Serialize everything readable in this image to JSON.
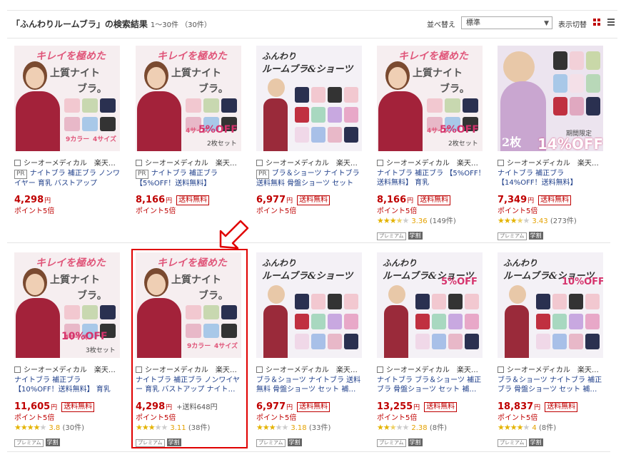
{
  "header": {
    "title": "「ふんわりルームブラ」の検索結果",
    "count": "1～30件 （30件）",
    "sort_label": "並べ替え",
    "sort_value": "標準",
    "view_label": "表示切替"
  },
  "colors": {
    "accent": "#bf0000",
    "link": "#1f3f8a",
    "star": "#e4b300",
    "highlight": "#e00000"
  },
  "products": [
    {
      "shop": "シーオーメディカル　楽天…",
      "pr": "PR",
      "name": "ナイトブラ 補正ブラ ノンワイヤー 育乳 バストアップ",
      "price": "4,298",
      "yen": "円",
      "shipping": "",
      "shipping_fee": "",
      "point": "ポイント5倍",
      "stars": 0,
      "score": "",
      "reviews": "",
      "badges": false,
      "ad": {
        "top": "キレイを極めた",
        "mid": "上質ナイト",
        "low": "ブラ。",
        "tag1": "9カラー",
        "tag2": "4サイズ",
        "off": "",
        "set": ""
      }
    },
    {
      "shop": "シーオーメディカル　楽天…",
      "pr": "PR",
      "name": "ナイトブラ 補正ブラ 【5%OFF！送料無料】",
      "price": "8,166",
      "yen": "円",
      "shipping": "送料無料",
      "shipping_fee": "",
      "point": "ポイント5倍",
      "stars": 0,
      "score": "",
      "reviews": "",
      "badges": false,
      "ad": {
        "top": "キレイを極めた",
        "mid": "上質ナイト",
        "low": "ブラ。",
        "tag1": "",
        "tag2": "4サイズ",
        "off": "5%OFF",
        "set": "2枚セット"
      }
    },
    {
      "shop": "シーオーメディカル　楽天…",
      "pr": "PR",
      "name": "ブラ＆ショーツ ナイトブラ 送料無料 骨盤ショーツ セット",
      "price": "6,977",
      "yen": "円",
      "shipping": "送料無料",
      "shipping_fee": "",
      "point": "ポイント5倍",
      "stars": 0,
      "score": "",
      "reviews": "",
      "badges": false,
      "ad": {
        "top": "ふんわり",
        "mid": "ルームブラ&ショーツ",
        "low": "",
        "tag1": "",
        "tag2": "",
        "off": "",
        "set": ""
      }
    },
    {
      "shop": "シーオーメディカル　楽天…",
      "pr": "",
      "name": "ナイトブラ 補正ブラ 【5%OFF！送料無料】 育乳",
      "price": "8,166",
      "yen": "円",
      "shipping": "送料無料",
      "shipping_fee": "",
      "point": "ポイント5倍",
      "stars": 3.5,
      "score": "3.36",
      "reviews": "(149件)",
      "badges": true,
      "ad": {
        "top": "キレイを極めた",
        "mid": "上質ナイト",
        "low": "ブラ。",
        "tag1": "",
        "tag2": "4サイズ",
        "off": "5%OFF",
        "set": "2枚セット"
      }
    },
    {
      "shop": "シーオーメディカル　楽天…",
      "pr": "",
      "name": "ナイトブラ 補正ブラ 【14%OFF！送料無料】",
      "price": "7,349",
      "yen": "円",
      "shipping": "送料無料",
      "shipping_fee": "",
      "point": "ポイント5倍",
      "stars": 3.5,
      "score": "3.43",
      "reviews": "(273件)",
      "badges": true,
      "ad": {
        "top": "",
        "mid": "",
        "low": "",
        "tag1": "2枚",
        "tag2": "期間限定",
        "off": "14%OFF",
        "set": ""
      }
    },
    {
      "shop": "シーオーメディカル　楽天…",
      "pr": "",
      "name": "ナイトブラ 補正ブラ 【10%OFF！送料無料】 育乳",
      "price": "11,605",
      "yen": "円",
      "shipping": "送料無料",
      "shipping_fee": "",
      "point": "ポイント5倍",
      "stars": 4,
      "score": "3.8",
      "reviews": "(30件)",
      "badges": true,
      "ad": {
        "top": "キレイを極めた",
        "mid": "上質ナイト",
        "low": "ブラ。",
        "tag1": "",
        "tag2": "4サイズ",
        "off": "10%OFF",
        "set": "3枚セット"
      }
    },
    {
      "shop": "シーオーメディカル　楽天…",
      "pr": "",
      "name": "ナイトブラ 補正ブラ ノンワイヤー 育乳 バストアップ ナイト…",
      "price": "4,298",
      "yen": "円",
      "shipping": "",
      "shipping_fee": "+送料648円",
      "point": "ポイント5倍",
      "stars": 3,
      "score": "3.11",
      "reviews": "(38件)",
      "badges": true,
      "ad": {
        "top": "キレイを極めた",
        "mid": "上質ナイト",
        "low": "ブラ。",
        "tag1": "9カラー",
        "tag2": "4サイズ",
        "off": "",
        "set": ""
      }
    },
    {
      "shop": "シーオーメディカル　楽天…",
      "pr": "",
      "name": "ブラ＆ショーツ ナイトブラ 送料無料 骨盤ショーツ セット 補…",
      "price": "6,977",
      "yen": "円",
      "shipping": "送料無料",
      "shipping_fee": "",
      "point": "ポイント5倍",
      "stars": 3,
      "score": "3.18",
      "reviews": "(33件)",
      "badges": true,
      "ad": {
        "top": "ふんわり",
        "mid": "ルームブラ&ショーツ",
        "low": "",
        "tag1": "",
        "tag2": "",
        "off": "",
        "set": ""
      }
    },
    {
      "shop": "シーオーメディカル　楽天…",
      "pr": "",
      "name": "ナイトブラ ブラ＆ショーツ 補正ブラ 骨盤ショーツ セット 補…",
      "price": "13,255",
      "yen": "円",
      "shipping": "送料無料",
      "shipping_fee": "",
      "point": "ポイント5倍",
      "stars": 2.5,
      "score": "2.38",
      "reviews": "(8件)",
      "badges": true,
      "ad": {
        "top": "ふんわり",
        "mid": "ルームブラ&ショーツ",
        "low": "",
        "tag1": "",
        "tag2": "",
        "off": "5%OFF",
        "set": ""
      }
    },
    {
      "shop": "シーオーメディカル　楽天…",
      "pr": "",
      "name": "ブラ＆ショーツ ナイトブラ 補正ブラ 骨盤ショーツ セット 補…",
      "price": "18,837",
      "yen": "円",
      "shipping": "送料無料",
      "shipping_fee": "",
      "point": "ポイント5倍",
      "stars": 4,
      "score": "4",
      "reviews": "(8件)",
      "badges": true,
      "ad": {
        "top": "ふんわり",
        "mid": "ルームブラ&ショーツ",
        "low": "",
        "tag1": "",
        "tag2": "",
        "off": "10%OFF",
        "set": ""
      }
    }
  ],
  "badge_labels": {
    "premium": "プレミアム",
    "gaku": "学割"
  }
}
